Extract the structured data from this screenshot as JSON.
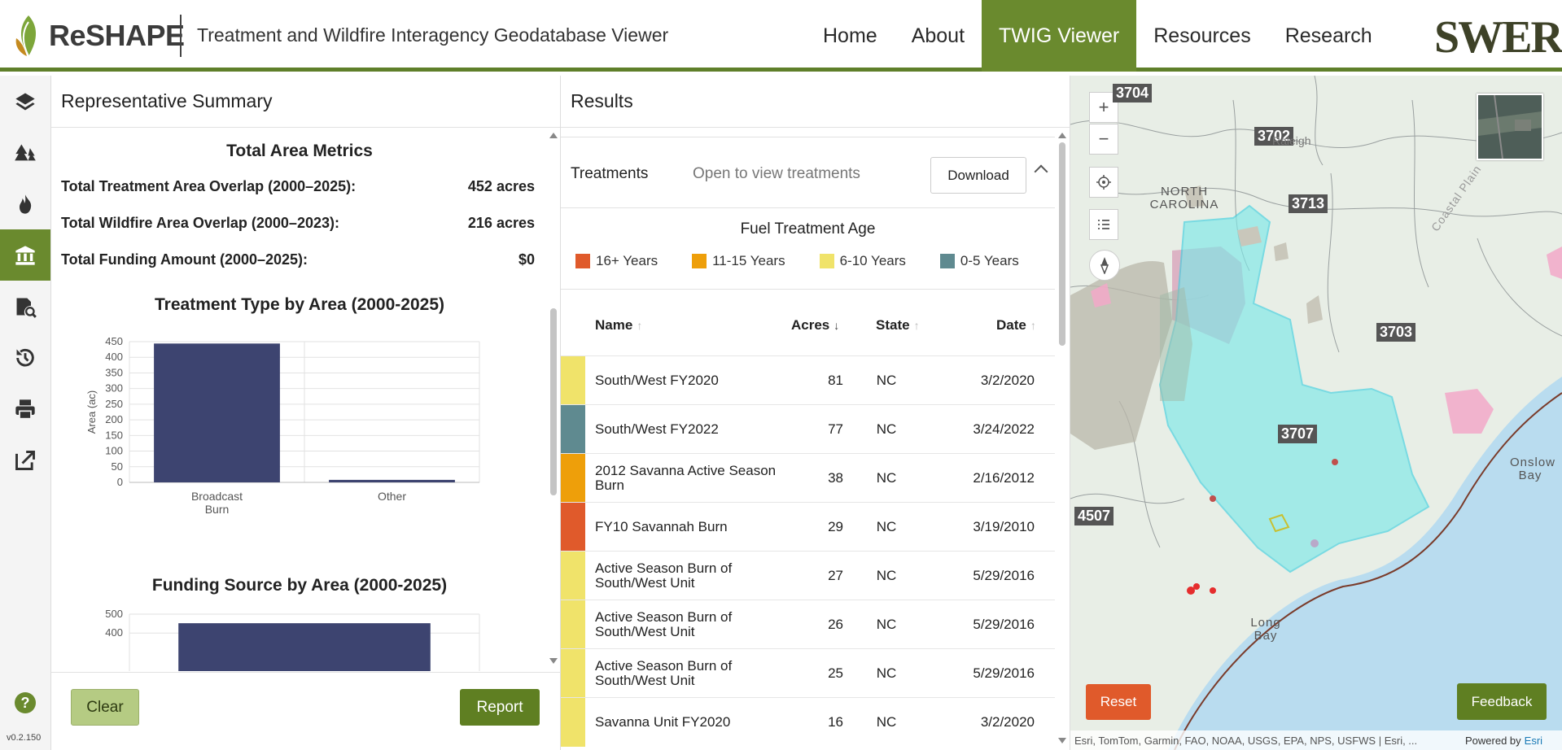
{
  "header": {
    "logo_text": "ReSHAPE",
    "app_title": "Treatment and Wildfire Interagency Geodatabase Viewer",
    "nav": [
      "Home",
      "About",
      "TWIG Viewer",
      "Resources",
      "Research"
    ],
    "active_nav": "TWIG Viewer",
    "partner_logo": "SWERI"
  },
  "toolbar": {
    "tools": [
      "layers-icon",
      "trees-icon",
      "fire-icon",
      "bank-icon",
      "search-document-icon",
      "history-icon",
      "print-icon",
      "export-icon"
    ],
    "active_tool": "bank-icon",
    "help_label": "?",
    "version": "v0.2.150"
  },
  "summary": {
    "title": "Representative Summary",
    "metrics_title": "Total Area Metrics",
    "metrics": [
      {
        "label": "Total Treatment Area Overlap (2000–2025):",
        "value": "452 acres"
      },
      {
        "label": "Total Wildfire Area Overlap (2000–2023):",
        "value": "216 acres"
      },
      {
        "label": "Total Funding Amount (2000–2025):",
        "value": "$0"
      }
    ],
    "clear_label": "Clear",
    "report_label": "Report"
  },
  "chart_data": [
    {
      "type": "bar",
      "title": "Treatment Type by Area (2000-2025)",
      "categories": [
        "Broadcast Burn",
        "Other"
      ],
      "category_lines": [
        [
          "Broadcast",
          "Burn"
        ],
        [
          "Other"
        ]
      ],
      "values": [
        444,
        8
      ],
      "ylabel": "Area (ac)",
      "xlabel": "",
      "ylim": [
        0,
        450
      ],
      "yticks": [
        0,
        50,
        100,
        150,
        200,
        250,
        300,
        350,
        400,
        450
      ],
      "grid": true,
      "color": "#3d4470"
    },
    {
      "type": "bar",
      "title": "Funding Source by Area (2000-2025)",
      "categories": [
        ""
      ],
      "values": [
        452
      ],
      "ylim": [
        0,
        500
      ],
      "yticks": [
        400,
        500
      ],
      "grid": true,
      "color": "#3d4470"
    }
  ],
  "results": {
    "title": "Results",
    "treatments_label": "Treatments",
    "treatments_hint": "Open to view treatments",
    "download_label": "Download",
    "age_title": "Fuel Treatment Age",
    "legend": [
      {
        "label": "16+ Years",
        "color": "#e05a2b"
      },
      {
        "label": "11-15 Years",
        "color": "#ee9f0a"
      },
      {
        "label": "6-10 Years",
        "color": "#f0e36a"
      },
      {
        "label": "0-5 Years",
        "color": "#5f8a90"
      }
    ],
    "columns": {
      "name": "Name",
      "acres": "Acres",
      "state": "State",
      "date": "Date"
    },
    "sorted_column": "Acres",
    "rows": [
      {
        "name": "South/West FY2020",
        "acres": "81",
        "state": "NC",
        "date": "3/2/2020",
        "color": "#f0e36a"
      },
      {
        "name": "South/West FY2022",
        "acres": "77",
        "state": "NC",
        "date": "3/24/2022",
        "color": "#5f8a90"
      },
      {
        "name": "2012 Savanna Active Season Burn",
        "acres": "38",
        "state": "NC",
        "date": "2/16/2012",
        "color": "#ee9f0a"
      },
      {
        "name": "FY10 Savannah Burn",
        "acres": "29",
        "state": "NC",
        "date": "3/19/2010",
        "color": "#e05a2b"
      },
      {
        "name": "Active Season Burn of South/West Unit",
        "acres": "27",
        "state": "NC",
        "date": "5/29/2016",
        "color": "#f0e36a"
      },
      {
        "name": "Active Season Burn of South/West Unit",
        "acres": "26",
        "state": "NC",
        "date": "5/29/2016",
        "color": "#f0e36a"
      },
      {
        "name": "Active Season Burn of South/West Unit",
        "acres": "25",
        "state": "NC",
        "date": "5/29/2016",
        "color": "#f0e36a"
      },
      {
        "name": "Savanna Unit FY2020",
        "acres": "16",
        "state": "NC",
        "date": "3/2/2020",
        "color": "#f0e36a"
      }
    ]
  },
  "map": {
    "zoom_in": "+",
    "zoom_out": "−",
    "route_labels": [
      "3704",
      "3702",
      "3713",
      "3703",
      "3707",
      "4507"
    ],
    "place_labels": [
      "NORTH CAROLINA",
      "Raleigh",
      "Onslow Bay",
      "Long Bay",
      "Coastal Plain"
    ],
    "reset_label": "Reset",
    "feedback_label": "Feedback",
    "attribution": "Esri, TomTom, Garmin, FAO, NOAA, USGS, EPA, NPS, USFWS | Esri, ...",
    "powered_by": "Powered by",
    "powered_brand": "Esri"
  }
}
